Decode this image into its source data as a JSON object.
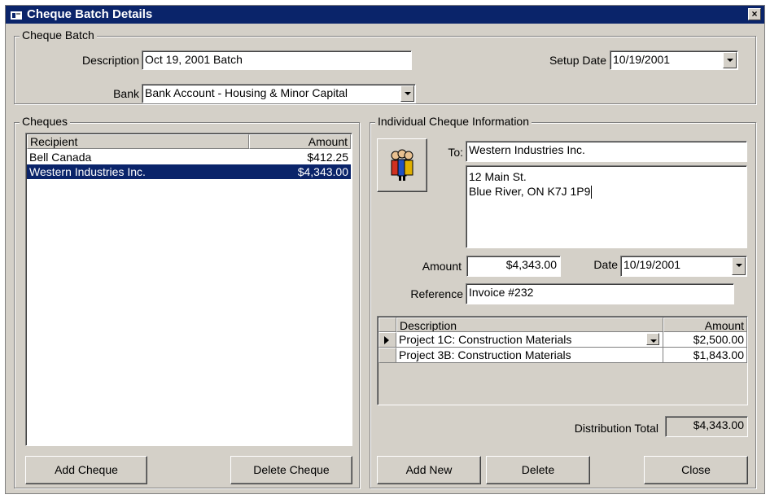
{
  "window": {
    "title": "Cheque Batch Details",
    "close_label": "×"
  },
  "batch": {
    "group_label": "Cheque Batch",
    "description_label": "Description",
    "description_value": "Oct 19, 2001 Batch",
    "setup_date_label": "Setup Date",
    "setup_date_value": "10/19/2001",
    "bank_label": "Bank",
    "bank_value": "Bank Account - Housing & Minor Capital"
  },
  "cheques": {
    "group_label": "Cheques",
    "columns": [
      "Recipient",
      "Amount"
    ],
    "rows": [
      {
        "recipient": "Bell Canada",
        "amount": "$412.25",
        "selected": false
      },
      {
        "recipient": "Western Industries Inc.",
        "amount": "$4,343.00",
        "selected": true
      }
    ],
    "add_button": "Add Cheque",
    "delete_button": "Delete Cheque"
  },
  "individual": {
    "group_label": "Individual Cheque Information",
    "to_label": "To:",
    "to_value": "Western Industries Inc.",
    "address_line1": "12 Main St.",
    "address_line2": "Blue River, ON  K7J 1P9",
    "amount_label": "Amount",
    "amount_value": "$4,343.00",
    "date_label": "Date",
    "date_value": "10/19/2001",
    "reference_label": "Reference",
    "reference_value": "Invoice #232",
    "dist_columns": [
      "Description",
      "Amount"
    ],
    "dist_rows": [
      {
        "description": "Project 1C:  Construction Materials",
        "amount": "$2,500.00",
        "current": true
      },
      {
        "description": "Project 3B:  Construction Materials",
        "amount": "$1,843.00",
        "current": false
      }
    ],
    "distribution_total_label": "Distribution Total",
    "distribution_total_value": "$4,343.00",
    "add_new_button": "Add New",
    "delete_button": "Delete",
    "close_button": "Close",
    "contacts_icon": "people-icon"
  },
  "colors": {
    "titlebar": "#0a246a",
    "face": "#d4d0c8",
    "selection": "#0a246a"
  }
}
